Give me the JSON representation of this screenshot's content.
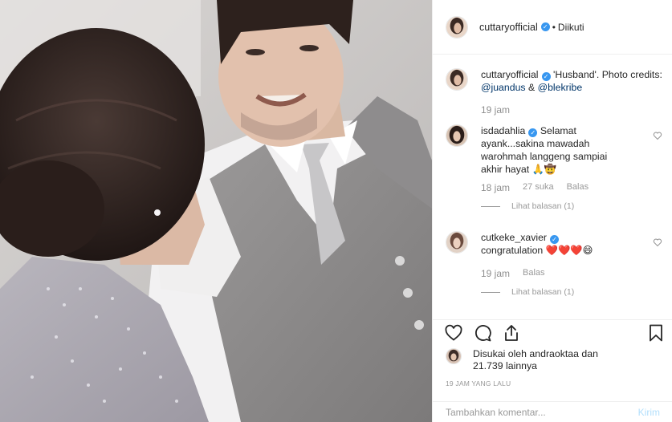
{
  "post": {
    "username": "cuttaryofficial",
    "follow_status": "Diikuti",
    "separator": "•",
    "verified_glyph": "✓",
    "caption": {
      "username": "cuttaryofficial",
      "text": "'Husband'. Photo credits:",
      "mention1": "@juandus",
      "amp": "&",
      "mention2": "@blekribe",
      "time": "19 jam"
    },
    "comments": [
      {
        "username": "isdadahlia",
        "text": "Selamat ayank...sakina mawadah warohmah langgeng sampiai akhir hayat 🙏🤠",
        "time": "18 jam",
        "likes": "27 suka",
        "reply": "Balas",
        "view_replies": "Lihat balasan (1)"
      },
      {
        "username": "cutkeke_xavier",
        "text": "congratulation ❤️❤️❤️😄",
        "time": "19 jam",
        "reply": "Balas",
        "view_replies": "Lihat balasan (1)"
      }
    ],
    "liked_by": {
      "prefix": "Disukai oleh",
      "user": "andraoktaa",
      "middle": "dan",
      "count": "21.739 lainnya"
    },
    "time_ago": "19 JAM YANG LALU",
    "add_comment_placeholder": "Tambahkan komentar...",
    "post_button": "Kirim"
  },
  "icons": {
    "like": "heart-icon",
    "comment": "comment-icon",
    "share": "share-icon",
    "save": "bookmark-icon",
    "comment_like": "heart-icon"
  },
  "colors": {
    "verified": "#3897f0",
    "mention": "#003569",
    "muted": "#999999",
    "post_button_disabled": "#b2dffc"
  }
}
